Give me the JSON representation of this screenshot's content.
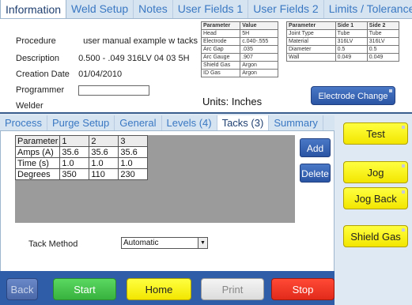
{
  "top_tabs": [
    "Information",
    "Weld Setup",
    "Notes",
    "User Fields 1",
    "User Fields 2",
    "Limits / Tolerances"
  ],
  "info": {
    "procedure_label": "Procedure",
    "procedure_value": "user manual example w tacks",
    "description_label": "Description",
    "description_value": "0.500 - .049 316LV 04 03 5H",
    "creation_date_label": "Creation Date",
    "creation_date_value": "01/04/2010",
    "programmer_label": "Programmer",
    "programmer_value": "",
    "welder_label": "Welder",
    "units_text": "Units: Inches",
    "electrode_change": "Electrode Change"
  },
  "param_table": {
    "headers": [
      "Parameter",
      "Value"
    ],
    "rows": [
      [
        "Head",
        "5H"
      ],
      [
        "Electrode",
        "c.040-.555"
      ],
      [
        "Arc Gap",
        ".035"
      ],
      [
        "Arc Gauge",
        ".907"
      ],
      [
        "Shield Gas",
        "Argon"
      ],
      [
        "ID Gas",
        "Argon"
      ]
    ]
  },
  "side_table": {
    "headers": [
      "Parameter",
      "Side 1",
      "Side 2"
    ],
    "rows": [
      [
        "Joint Type",
        "Tube",
        "Tube"
      ],
      [
        "Material",
        "316LV",
        "316LV"
      ],
      [
        "Diameter",
        "0.5",
        "0.5"
      ],
      [
        "Wall",
        "0.049",
        "0.049"
      ]
    ]
  },
  "sub_tabs": [
    "Process",
    "Purge Setup",
    "General",
    "Levels (4)",
    "Tacks (3)",
    "Summary"
  ],
  "tacks": {
    "headers": [
      "Parameter",
      "1",
      "2",
      "3"
    ],
    "rows": [
      [
        "Amps (A)",
        "35.6",
        "35.6",
        "35.6"
      ],
      [
        "Time (s)",
        "1.0",
        "1.0",
        "1.0"
      ],
      [
        "Degrees",
        "350",
        "110",
        "230"
      ]
    ],
    "add_label": "Add",
    "delete_label": "Delete",
    "method_label": "Tack Method",
    "method_value": "Automatic"
  },
  "right_buttons": [
    "Test",
    "Jog",
    "Jog Back",
    "Shield Gas"
  ],
  "bottom_buttons": [
    "Back",
    "Start",
    "Home",
    "Print",
    "Stop"
  ],
  "colors": {
    "accent_blue": "#2f5da8",
    "tab_text": "#3a78c2",
    "yellow_button": "#ffff40",
    "green_start": "#44c84a",
    "red_stop": "#ee3322",
    "gray_print": "#e8e8e8"
  },
  "icons": {
    "dropdown_arrow": "chevron-down-icon"
  }
}
